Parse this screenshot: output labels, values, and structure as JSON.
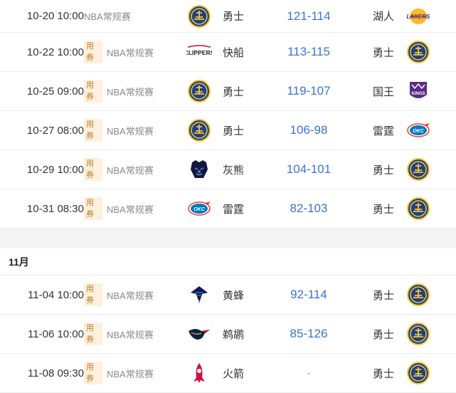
{
  "games_a": [
    {
      "time": "10-20 10:00",
      "tag": "",
      "league": "NBA常规赛",
      "home": {
        "name": "勇士",
        "logo": "warriors-logo"
      },
      "score": "121-114",
      "away": {
        "name": "湖人",
        "logo": "lakers-logo"
      }
    },
    {
      "time": "10-22 10:00",
      "tag": "用券",
      "league": "NBA常规赛",
      "home": {
        "name": "快船",
        "logo": "clippers-logo"
      },
      "score": "113-115",
      "away": {
        "name": "勇士",
        "logo": "warriors-logo"
      }
    },
    {
      "time": "10-25 09:00",
      "tag": "用券",
      "league": "NBA常规赛",
      "home": {
        "name": "勇士",
        "logo": "warriors-logo"
      },
      "score": "119-107",
      "away": {
        "name": "国王",
        "logo": "kings-logo"
      }
    },
    {
      "time": "10-27 08:00",
      "tag": "用券",
      "league": "NBA常规赛",
      "home": {
        "name": "勇士",
        "logo": "warriors-logo"
      },
      "score": "106-98",
      "away": {
        "name": "雷霆",
        "logo": "thunder-logo"
      }
    },
    {
      "time": "10-29 10:00",
      "tag": "用券",
      "league": "NBA常规赛",
      "home": {
        "name": "灰熊",
        "logo": "grizzlies-logo"
      },
      "score": "104-101",
      "away": {
        "name": "勇士",
        "logo": "warriors-logo"
      }
    },
    {
      "time": "10-31 08:30",
      "tag": "用券",
      "league": "NBA常规赛",
      "home": {
        "name": "雷霆",
        "logo": "thunder-logo"
      },
      "score": "82-103",
      "away": {
        "name": "勇士",
        "logo": "warriors-logo"
      }
    }
  ],
  "month_label": "11月",
  "games_b": [
    {
      "time": "11-04 10:00",
      "tag": "用券",
      "league": "NBA常规赛",
      "home": {
        "name": "黄蜂",
        "logo": "hornets-logo"
      },
      "score": "92-114",
      "away": {
        "name": "勇士",
        "logo": "warriors-logo"
      }
    },
    {
      "time": "11-06 10:00",
      "tag": "用券",
      "league": "NBA常规赛",
      "home": {
        "name": "鹈鹕",
        "logo": "pelicans-logo"
      },
      "score": "85-126",
      "away": {
        "name": "勇士",
        "logo": "warriors-logo"
      }
    },
    {
      "time": "11-08 09:30",
      "tag": "用券",
      "league": "NBA常规赛",
      "home": {
        "name": "火箭",
        "logo": "rockets-logo"
      },
      "score": "-",
      "away": {
        "name": "勇士",
        "logo": "warriors-logo"
      }
    }
  ],
  "colors": {
    "score": "#3a73d6",
    "tag_bg": "#fdf0dc",
    "tag_text": "#b97d2a",
    "divider": "#f4f4f4"
  }
}
